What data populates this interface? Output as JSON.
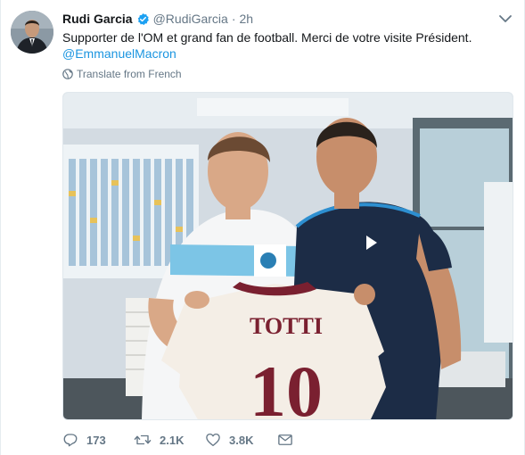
{
  "tweet": {
    "author_name": "Rudi Garcia",
    "author_handle": "@RudiGarcia",
    "separator": "·",
    "timestamp": "2h",
    "text": "Supporter de l'OM et grand fan de football. Merci de votre visite Président.",
    "mention": "@EmmanuelMacron",
    "translate_label": "Translate from French",
    "photo": {
      "jersey_name": "TOTTI",
      "jersey_number": "10"
    }
  },
  "actions": {
    "reply_count": "173",
    "retweet_count": "2.1K",
    "like_count": "3.8K"
  },
  "icons": {
    "verified": "verified-badge-icon",
    "caret": "chevron-down-icon",
    "translate": "globe-icon",
    "reply": "reply-icon",
    "retweet": "retweet-icon",
    "like": "heart-icon",
    "message": "envelope-icon"
  },
  "colors": {
    "link": "#1b95e0",
    "verified": "#1da1f2",
    "muted": "#657786",
    "text": "#14171a"
  }
}
